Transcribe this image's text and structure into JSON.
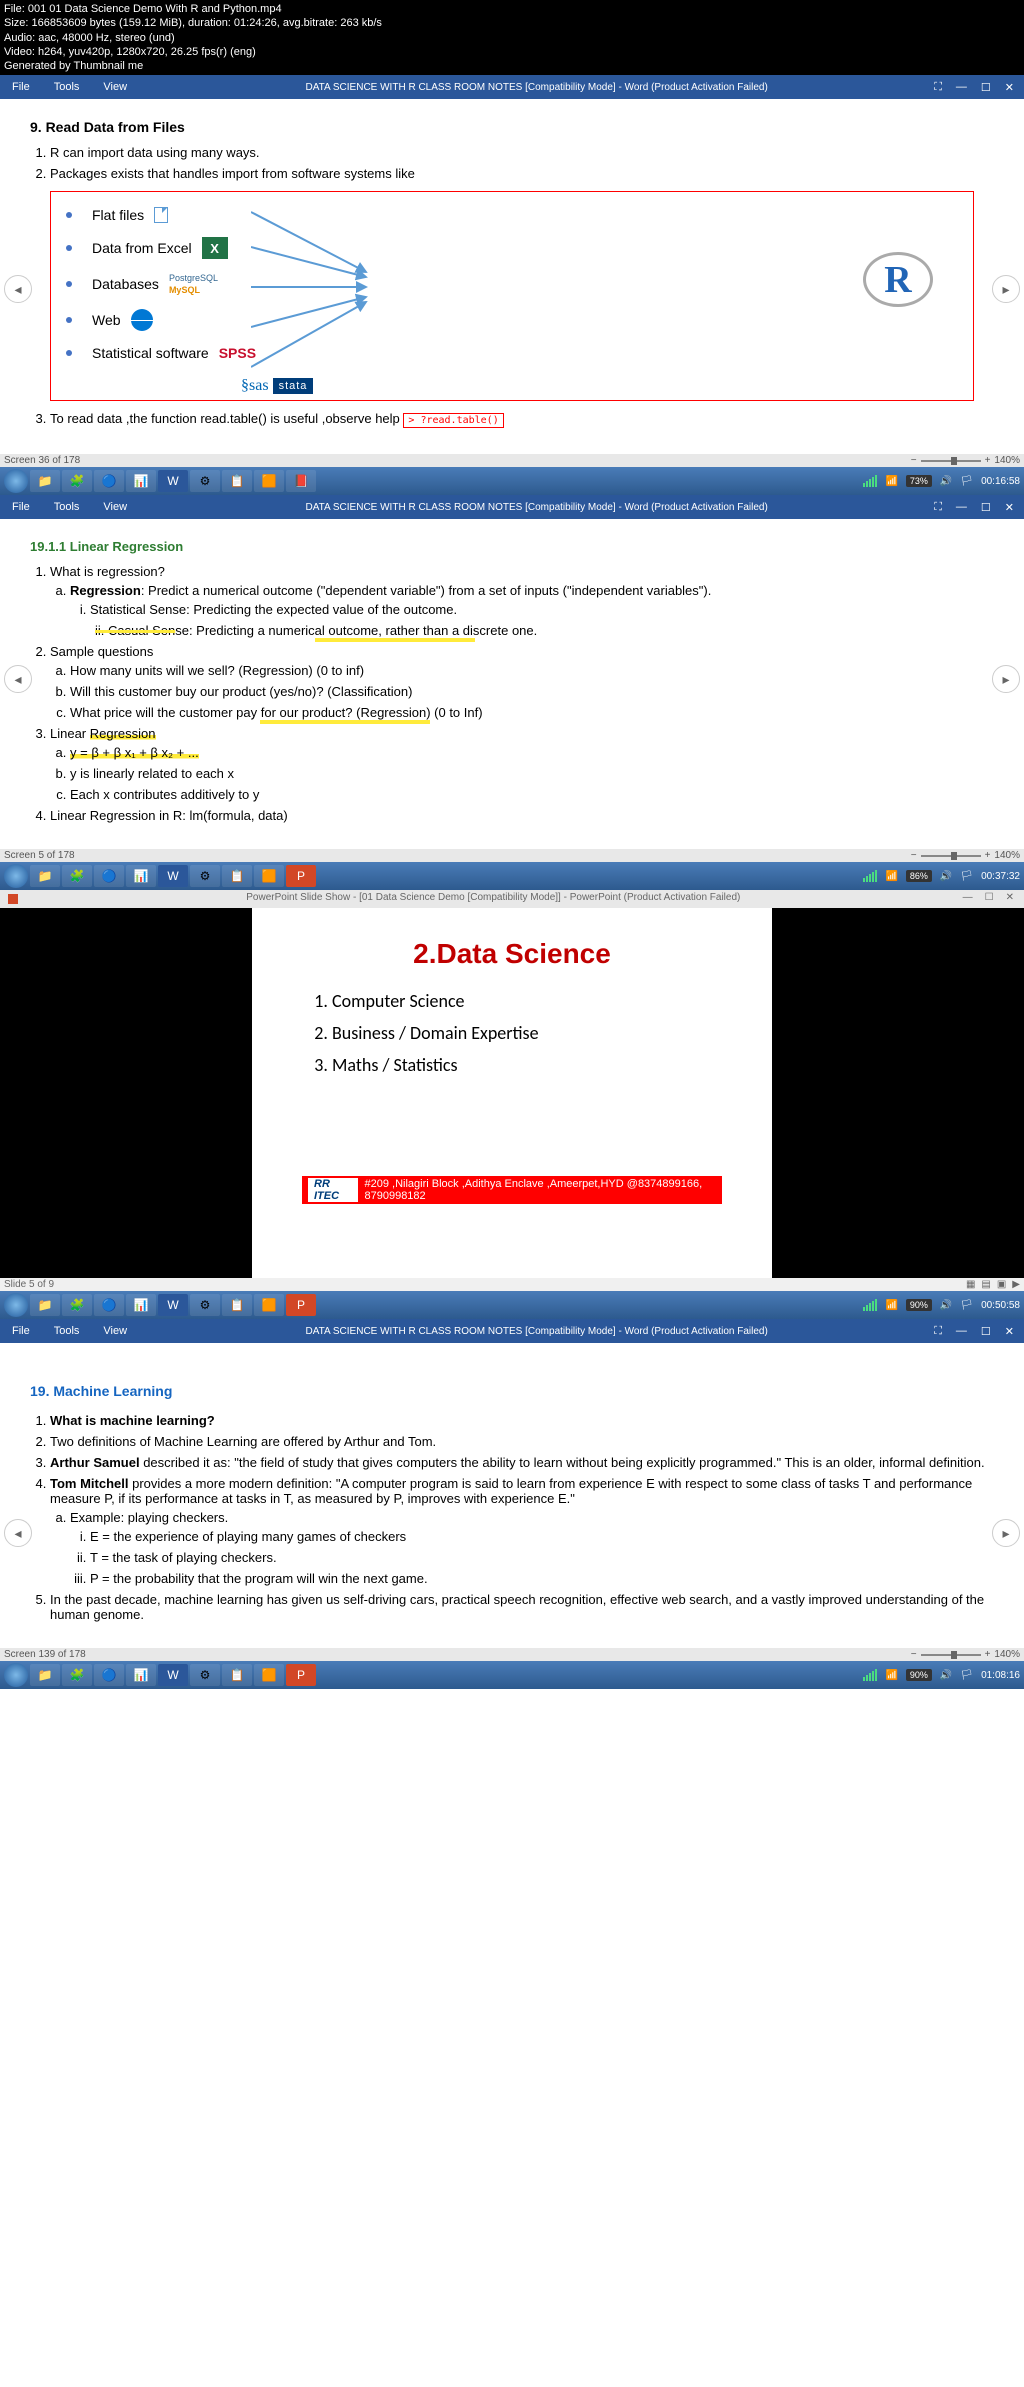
{
  "meta": {
    "file": "File: 001 01 Data Science Demo With R and Python.mp4",
    "size": "Size: 166853609 bytes (159.12 MiB), duration: 01:24:26, avg.bitrate: 263 kb/s",
    "audio": "Audio: aac, 48000 Hz, stereo (und)",
    "video": "Video: h264, yuv420p, 1280x720, 26.25 fps(r) (eng)",
    "generated": "Generated by Thumbnail me"
  },
  "ribbon": {
    "file": "File",
    "tools": "Tools",
    "view": "View",
    "title": "DATA SCIENCE WITH R CLASS ROOM NOTES [Compatibility Mode] - Word (Product Activation Failed)"
  },
  "doc1": {
    "heading": "9. Read Data from Files",
    "item1": "R can import data using many ways.",
    "item2": "Packages exists that handles import from software systems like",
    "diag": {
      "flat": "Flat files",
      "excel": "Data from Excel",
      "db": "Databases",
      "web": "Web",
      "stat": "Statistical software",
      "postgres": "PostgreSQL",
      "mysql": "MySQL",
      "spss": "SPSS",
      "sas": "sas",
      "stata": "stata",
      "r": "R"
    },
    "item3": "To read data ,the function read.table() is useful ,observe help",
    "help_cmd": "> ?read.table()"
  },
  "screen1": {
    "label": "Screen 36 of 178",
    "zoom": "140%",
    "battery": "73%",
    "time": "00:16:58"
  },
  "doc2": {
    "heading": "19.1.1 Linear Regression",
    "q1": "What is regression?",
    "q1a_b": "Regression",
    "q1a_t": ": Predict a numerical outcome (\"dependent variable\") from a set of inputs (\"independent variables\").",
    "q1ai": "Statistical Sense: Predicting the expected value of the outcome.",
    "q1aii_pre": "ii. ",
    "q1aii_s": "Casual Sen",
    "q1aii_post": "se: Predicting a numerical outcome, rather than a discrete one.",
    "q2": "Sample questions",
    "q2a": "How many units will we sell? (Regression) (0 to inf)",
    "q2b": "Will this customer buy our product (yes/no)? (Classification)",
    "q2c": "What price will the customer pay for our product? (Regression) (0 to Inf)",
    "q3_pre": "Linear ",
    "q3_hl": "Regression",
    "q3a": "y = β + β x₁ + β x₂ + ...",
    "q3b": "y is linearly related to each x",
    "q3c": "Each x contributes additively to y",
    "q4": "Linear Regression in R: lm(formula, data)"
  },
  "screen2": {
    "label": "Screen 5 of 178",
    "zoom": "140%",
    "battery": "86%",
    "time": "00:37:32"
  },
  "ppt": {
    "bar_title": "PowerPoint Slide Show - [01 Data Science Demo [Compatibility Mode]] - PowerPoint (Product Activation Failed)",
    "title": "2.Data Science",
    "item1": "Computer Science",
    "item2": "Business / Domain Expertise",
    "item3": "Maths / Statistics",
    "footer_logo": "RR ITEC",
    "footer_text": "#209 ,Nilagiri Block ,Adithya Enclave ,Ameerpet,HYD @8374899166, 8790998182"
  },
  "slide_label": "Slide 5 of 9",
  "screen3": {
    "battery": "90%",
    "time": "00:50:58"
  },
  "doc3": {
    "heading": "19. Machine Learning",
    "q1": "What is machine learning?",
    "q2": "Two definitions of Machine Learning are offered by Arthur and Tom.",
    "q3_b": "Arthur Samuel",
    "q3_t": " described it as: \"the field of study that gives computers the ability to learn without being explicitly programmed.\" This is an older, informal definition.",
    "q4_b": "Tom Mitchell",
    "q4_t": " provides a more modern definition: \"A computer program is said to learn from experience E with respect to some class of tasks T and performance measure P, if its performance at tasks in T, as measured by P, improves with experience E.\"",
    "q4a": "Example: playing checkers.",
    "q4ai": "E = the experience of playing many games of checkers",
    "q4aii": "T = the task of playing checkers.",
    "q4aiii": "P = the probability that the program will win the next game.",
    "q5": "In the past decade, machine learning has given us self-driving cars, practical speech recognition, effective web search, and a vastly improved understanding of the human genome."
  },
  "screen4": {
    "label": "Screen 139 of 178",
    "zoom": "140%",
    "battery": "90%",
    "time": "01:08:16"
  }
}
